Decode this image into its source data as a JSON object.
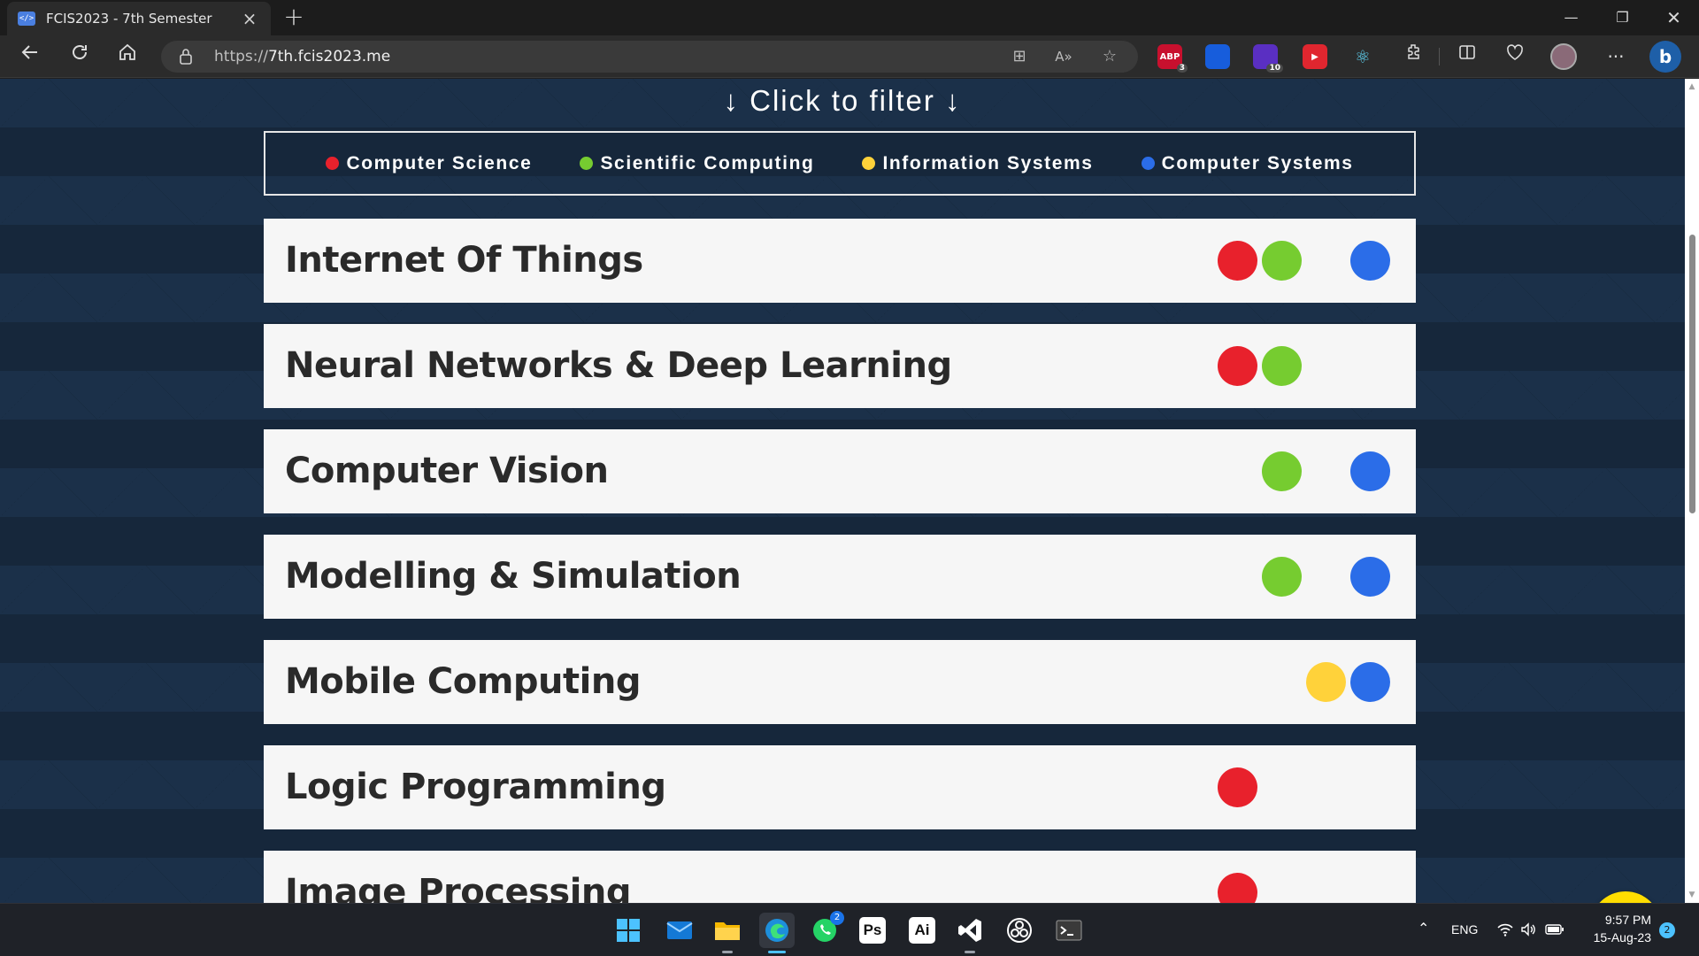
{
  "browser": {
    "tab_title": "FCIS2023 - 7th Semester",
    "tab_favicon": "</>",
    "url_scheme": "https://",
    "url_host": "7th.fcis2023.me",
    "extensions": [
      {
        "name": "adblock-plus-icon",
        "label": "ABP",
        "badge": "3",
        "color": "#c8102e"
      },
      {
        "name": "bitwarden-icon",
        "label": "",
        "badge": "",
        "color": "#175ddc"
      },
      {
        "name": "extension-purple-icon",
        "label": "",
        "badge": "10",
        "color": "#5a2fc2"
      },
      {
        "name": "youtube-ext-icon",
        "label": "▶",
        "badge": "",
        "color": "#e0262f"
      },
      {
        "name": "react-devtools-icon",
        "label": "⚛",
        "badge": "",
        "color": "transparent"
      }
    ]
  },
  "page": {
    "filter_heading": "↓ Click to filter ↓",
    "filters": [
      {
        "label": "Computer Science",
        "color": "#e8212c"
      },
      {
        "label": "Scientific Computing",
        "color": "#76cc30"
      },
      {
        "label": "Information Systems",
        "color": "#ffd23a"
      },
      {
        "label": "Computer Systems",
        "color": "#2b6de8"
      }
    ],
    "courses": [
      {
        "name": "Internet Of Things",
        "tracks": [
          "Computer Science",
          "Scientific Computing",
          "Computer Systems"
        ]
      },
      {
        "name": "Neural Networks & Deep Learning",
        "tracks": [
          "Computer Science",
          "Scientific Computing"
        ]
      },
      {
        "name": "Computer Vision",
        "tracks": [
          "Scientific Computing",
          "Computer Systems"
        ]
      },
      {
        "name": "Modelling & Simulation",
        "tracks": [
          "Scientific Computing",
          "Computer Systems"
        ]
      },
      {
        "name": "Mobile Computing",
        "tracks": [
          "Information Systems",
          "Computer Systems"
        ]
      },
      {
        "name": "Logic Programming",
        "tracks": [
          "Computer Science"
        ]
      },
      {
        "name": "Image Processing",
        "tracks": [
          "Computer Science"
        ]
      }
    ]
  },
  "taskbar": {
    "apps": [
      {
        "name": "start-icon"
      },
      {
        "name": "mail-icon"
      },
      {
        "name": "file-explorer-icon"
      },
      {
        "name": "edge-icon",
        "active": true
      },
      {
        "name": "whatsapp-icon",
        "badge": "2"
      },
      {
        "name": "photoshop-icon",
        "label": "Ps"
      },
      {
        "name": "illustrator-icon",
        "label": "Ai"
      },
      {
        "name": "vscode-icon"
      },
      {
        "name": "obs-icon"
      },
      {
        "name": "terminal-icon"
      }
    ],
    "language": "ENG",
    "time": "9:57 PM",
    "date": "15-Aug-23",
    "notification_count": "2"
  }
}
